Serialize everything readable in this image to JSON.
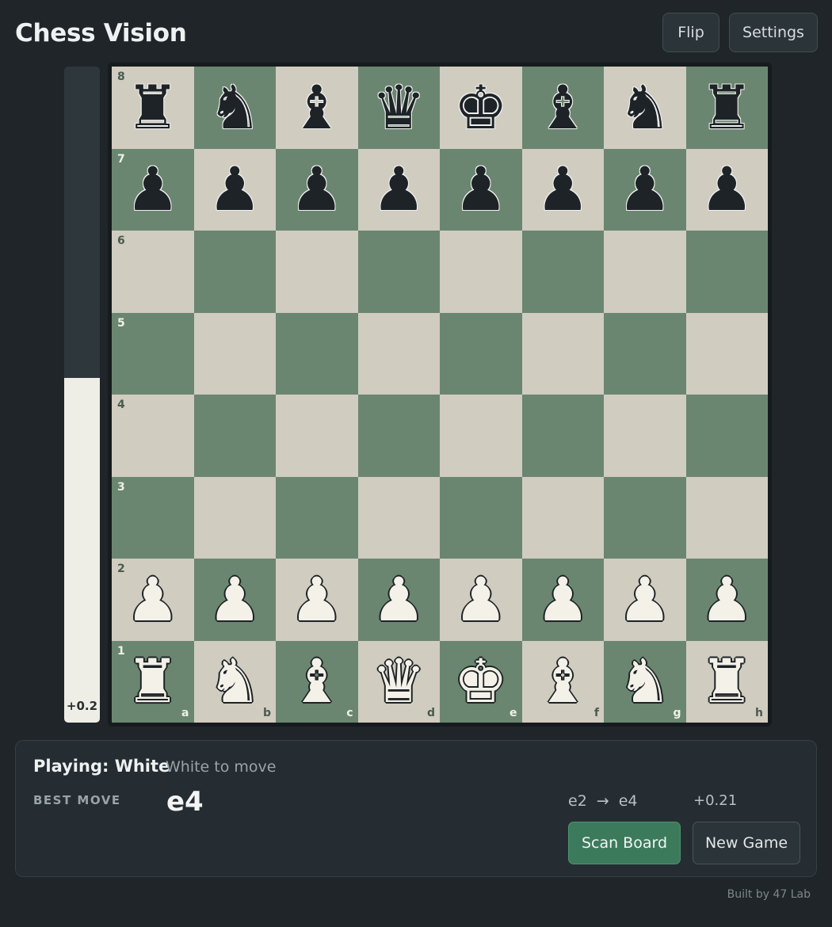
{
  "header": {
    "title": "Chess Vision",
    "flip_label": "Flip",
    "settings_label": "Settings"
  },
  "eval_bar": {
    "label": "+0.2",
    "white_fraction": 0.525
  },
  "board": {
    "orientation": "white",
    "files": [
      "a",
      "b",
      "c",
      "d",
      "e",
      "f",
      "g",
      "h"
    ],
    "ranks": [
      "8",
      "7",
      "6",
      "5",
      "4",
      "3",
      "2",
      "1"
    ],
    "position": [
      [
        "bR",
        "bN",
        "bB",
        "bQ",
        "bK",
        "bB",
        "bN",
        "bR"
      ],
      [
        "bP",
        "bP",
        "bP",
        "bP",
        "bP",
        "bP",
        "bP",
        "bP"
      ],
      [
        "",
        "",
        "",
        "",
        "",
        "",
        "",
        ""
      ],
      [
        "",
        "",
        "",
        "",
        "",
        "",
        "",
        ""
      ],
      [
        "",
        "",
        "",
        "",
        "",
        "",
        "",
        ""
      ],
      [
        "",
        "",
        "",
        "",
        "",
        "",
        "",
        ""
      ],
      [
        "wP",
        "wP",
        "wP",
        "wP",
        "wP",
        "wP",
        "wP",
        "wP"
      ],
      [
        "wR",
        "wN",
        "wB",
        "wQ",
        "wK",
        "wB",
        "wN",
        "wR"
      ]
    ],
    "colors": {
      "light": "#d0ccc0",
      "dark": "#6a8670"
    }
  },
  "panel": {
    "playing": "Playing: White",
    "to_move": "White to move",
    "best_move_label": "BEST MOVE",
    "best_move": "e4",
    "from": "e2",
    "arrow": "→",
    "to": "e4",
    "eval": "+0.21",
    "scan_label": "Scan Board",
    "new_game_label": "New Game"
  },
  "footer": {
    "credit": "Built by 47 Lab"
  },
  "accent": "#3c7a5c"
}
